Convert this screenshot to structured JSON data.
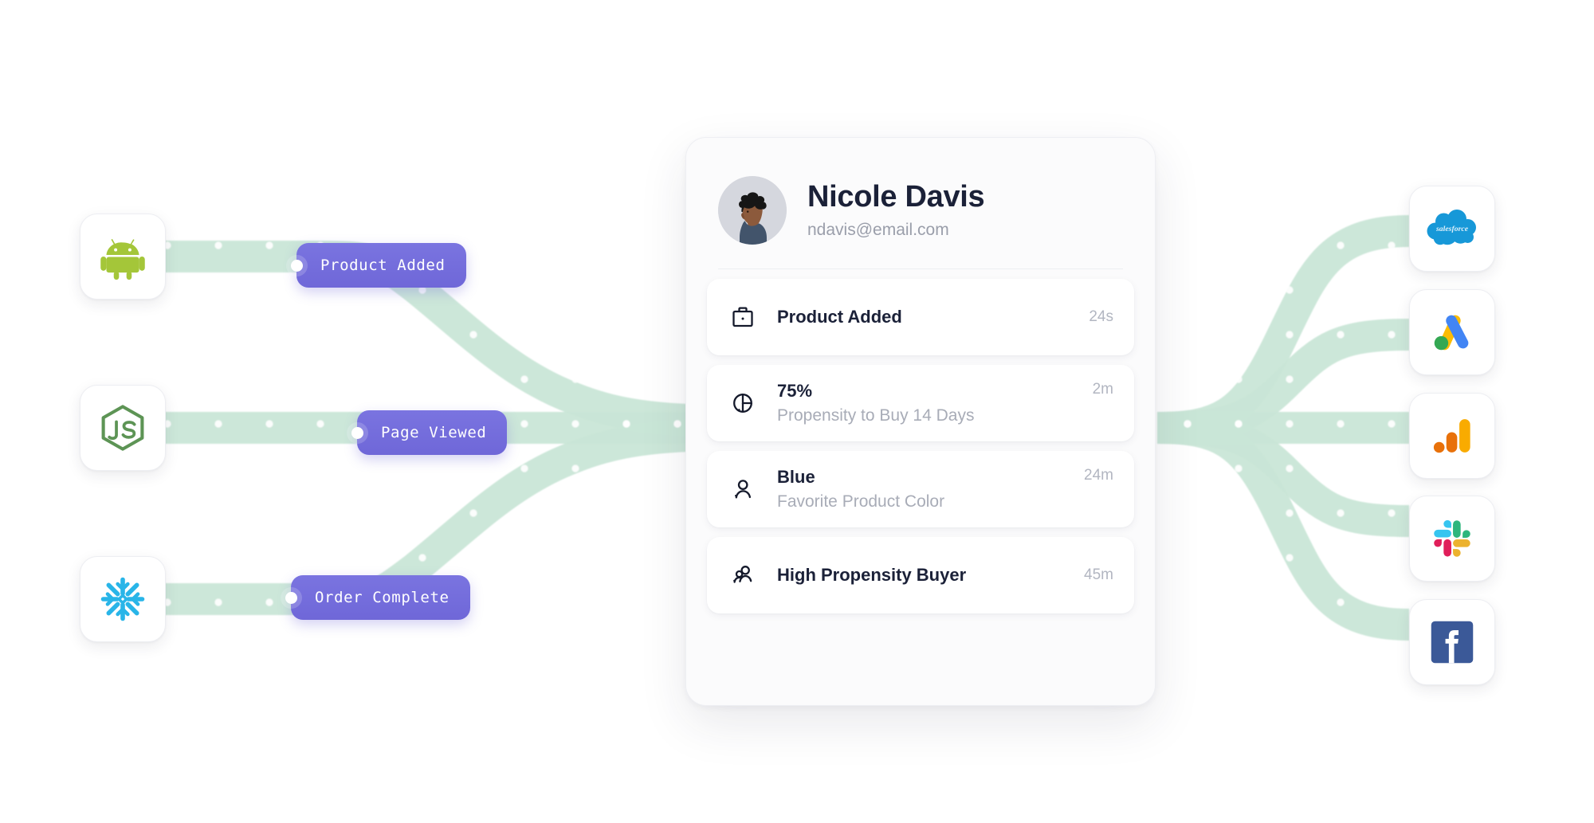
{
  "sources": [
    {
      "name": "Android",
      "icon": "android-icon"
    },
    {
      "name": "Node.js",
      "icon": "nodejs-icon"
    },
    {
      "name": "Snowflake",
      "icon": "snowflake-icon"
    }
  ],
  "events": [
    {
      "label": "Product Added",
      "icon": "event-dot-icon"
    },
    {
      "label": "Page Viewed",
      "icon": "event-dot-icon"
    },
    {
      "label": "Order Complete",
      "icon": "event-dot-icon"
    }
  ],
  "profile": {
    "name": "Nicole Davis",
    "email": "ndavis@email.com",
    "avatar_icon": "avatar-illustration",
    "traits": [
      {
        "icon": "briefcase-icon",
        "title": "Product Added",
        "subtitle": "",
        "time": "24s"
      },
      {
        "icon": "pie-chart-icon",
        "title": "75%",
        "subtitle": "Propensity to Buy 14 Days",
        "time": "2m"
      },
      {
        "icon": "person-icon",
        "title": "Blue",
        "subtitle": "Favorite Product Color",
        "time": "24m"
      },
      {
        "icon": "people-icon",
        "title": "High Propensity Buyer",
        "subtitle": "",
        "time": "45m"
      }
    ]
  },
  "destinations": [
    {
      "name": "Salesforce",
      "icon": "salesforce-icon"
    },
    {
      "name": "Google Ads",
      "icon": "google-ads-icon"
    },
    {
      "name": "Google Analytics",
      "icon": "google-analytics-icon"
    },
    {
      "name": "Slack",
      "icon": "slack-icon"
    },
    {
      "name": "Facebook",
      "icon": "facebook-icon"
    }
  ],
  "colors": {
    "pill": "#7169da",
    "ribbon": "#c9e6d7",
    "card_bg": "#fbfbfc",
    "page_bg": "#ffffff",
    "heading": "#1b2138",
    "muted": "#a8acb7",
    "android_green": "#a4c639",
    "node_green": "#5d9455",
    "snowflake_blue": "#29b5e8",
    "salesforce_blue": "#1798d8",
    "facebook_blue": "#3b5998"
  }
}
